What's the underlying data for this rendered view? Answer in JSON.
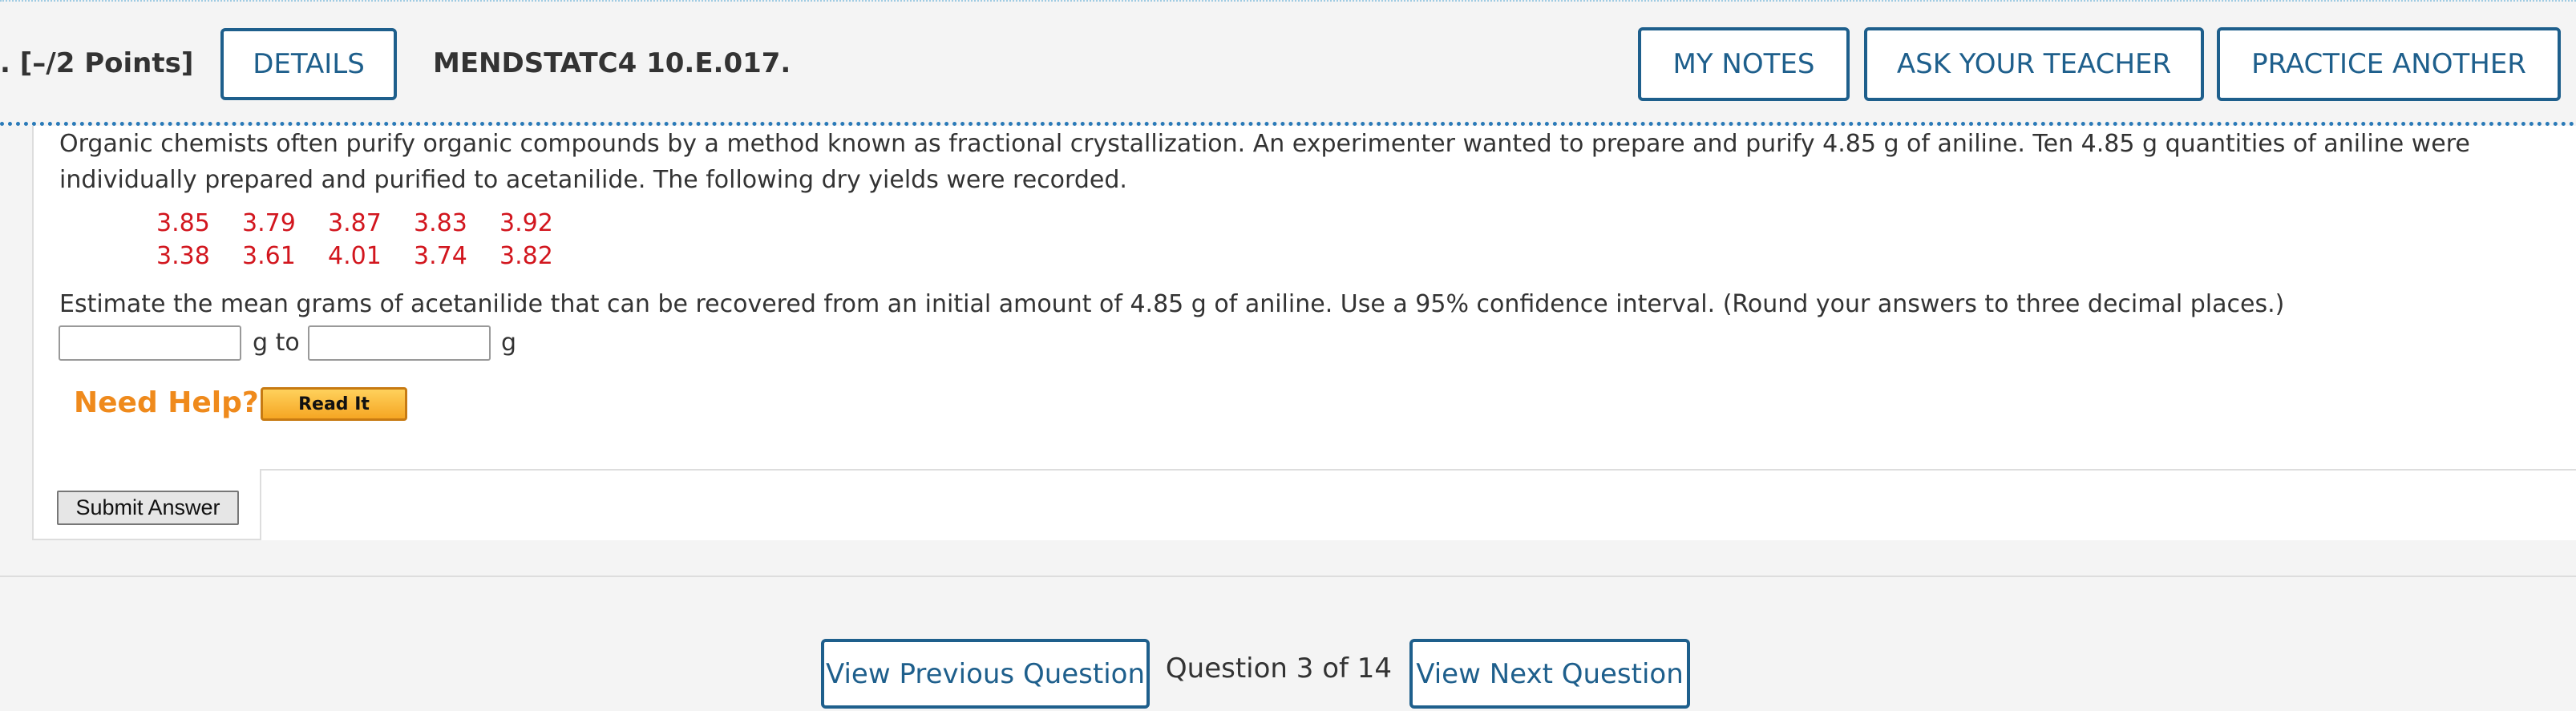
{
  "header": {
    "points": ". [–/2 Points]",
    "details_label": "DETAILS",
    "assignment_id": "MENDSTATC4 10.E.017.",
    "my_notes_label": "MY NOTES",
    "ask_teacher_label": "ASK YOUR TEACHER",
    "practice_label": "PRACTICE ANOTHER"
  },
  "question": {
    "text": "Organic chemists often purify organic compounds by a method known as fractional crystallization. An experimenter wanted to prepare and purify 4.85 g of aniline. Ten 4.85 g quantities of aniline were individually prepared and purified to acetanilide. The following dry yields were recorded.",
    "data_rows": [
      [
        "3.85",
        "3.79",
        "3.87",
        "3.83",
        "3.92"
      ],
      [
        "3.38",
        "3.61",
        "4.01",
        "3.74",
        "3.82"
      ]
    ],
    "instruction": "Estimate the mean grams of acetanilide that can be recovered from an initial amount of 4.85 g of aniline. Use a 95% confidence interval. (Round your answers to three decimal places.)",
    "input_lower_value": "",
    "input_upper_value": "",
    "unit_between": "g to",
    "unit_after": "g"
  },
  "help": {
    "need_help_label": "Need Help?",
    "read_it_label": "Read It"
  },
  "submit_label": "Submit Answer",
  "navigation": {
    "previous_label": "View Previous Question",
    "counter": "Question 3 of 14",
    "next_label": "View Next Question"
  },
  "colors": {
    "accent": "#1e5f8c",
    "data_values": "#d2161e",
    "need_help": "#ef8a1c"
  }
}
